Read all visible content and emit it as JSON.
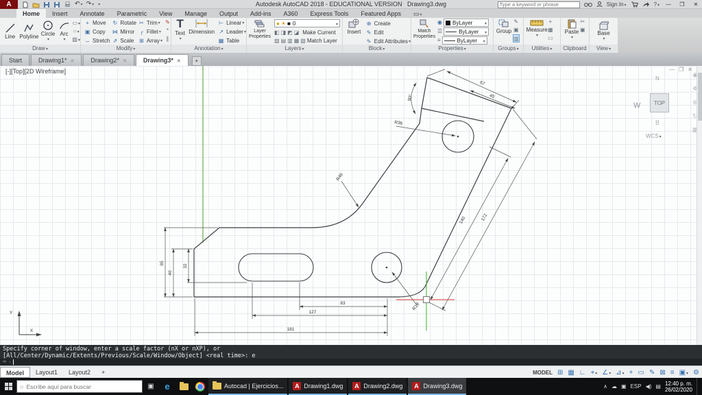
{
  "app": {
    "title": "Autodesk AutoCAD 2018 - EDUCATIONAL VERSION",
    "doc": "Drawing3.dwg",
    "search_placeholder": "Type a keyword or phrase",
    "sign_in": "Sign In"
  },
  "ribbon": {
    "tabs": [
      {
        "label": "Home"
      },
      {
        "label": "Insert"
      },
      {
        "label": "Annotate"
      },
      {
        "label": "Parametric"
      },
      {
        "label": "View"
      },
      {
        "label": "Manage"
      },
      {
        "label": "Output"
      },
      {
        "label": "Add-ins"
      },
      {
        "label": "A360"
      },
      {
        "label": "Express Tools"
      },
      {
        "label": "Featured Apps"
      }
    ],
    "active_tab": "Home",
    "draw": {
      "label": "Draw",
      "big": [
        {
          "label": "Line"
        },
        {
          "label": "Polyline"
        },
        {
          "label": "Circle"
        },
        {
          "label": "Arc"
        }
      ],
      "extra": [
        {
          "name": "rectangle",
          "glyph": "▭"
        },
        {
          "name": "ellipse",
          "glyph": "○"
        },
        {
          "name": "hatch",
          "glyph": "▨"
        }
      ]
    },
    "modify": {
      "label": "Modify",
      "small": [
        {
          "label": "Move",
          "glyph": "+"
        },
        {
          "label": "Copy",
          "glyph": "▣"
        },
        {
          "label": "Stretch",
          "glyph": "↔"
        },
        {
          "label": "Rotate",
          "glyph": "↻"
        },
        {
          "label": "Mirror",
          "glyph": "⋈"
        },
        {
          "label": "Scale",
          "glyph": "⇗"
        },
        {
          "label": "Trim",
          "glyph": "✂"
        },
        {
          "label": "Fillet",
          "glyph": "╭"
        },
        {
          "label": "Array",
          "glyph": "⊞"
        }
      ],
      "extra": [
        {
          "name": "erase",
          "glyph": "✎"
        },
        {
          "name": "explode",
          "glyph": "*"
        },
        {
          "name": "offset",
          "glyph": "∥"
        }
      ]
    },
    "annotation": {
      "label": "Annotation",
      "big": [
        {
          "label": "Text"
        },
        {
          "label": "Dimension"
        }
      ],
      "small": [
        {
          "label": "Linear",
          "glyph": "⊢"
        },
        {
          "label": "Leader",
          "glyph": "↗"
        },
        {
          "label": "Table",
          "glyph": "▦"
        }
      ]
    },
    "layers": {
      "label": "Layers",
      "big_label": "Layer Properties",
      "current_layer": "0",
      "state_glyphs": [
        "●",
        "☀",
        "■"
      ],
      "row2": [
        "◧",
        "◨",
        "◩",
        "◪"
      ],
      "row3": [
        "▨",
        "▤",
        "▥",
        "▦",
        "▧"
      ],
      "small": [
        {
          "label": "Make Current"
        },
        {
          "label": "Match Layer"
        }
      ]
    },
    "block": {
      "label": "Block",
      "big_label": "Insert",
      "small": [
        {
          "label": "Create",
          "glyph": "⊕"
        },
        {
          "label": "Edit",
          "glyph": "✎"
        },
        {
          "label": "Edit Attributes",
          "glyph": "✎"
        }
      ]
    },
    "properties": {
      "label": "Properties",
      "big_label": "Match Properties",
      "row_glyphs": [
        "◉",
        "☰",
        "≡"
      ],
      "rows": [
        {
          "value": "ByLayer"
        },
        {
          "value": "ByLayer"
        },
        {
          "value": "ByLayer"
        }
      ]
    },
    "groups": {
      "label": "Groups",
      "big_label": "Group",
      "extra": [
        {
          "name": "group-edit",
          "glyph": "✎"
        },
        {
          "name": "ungroup",
          "glyph": "▣"
        },
        {
          "name": "group-selection-on",
          "glyph": "▥"
        }
      ]
    },
    "utilities": {
      "label": "Utilities",
      "big_label": "Measure",
      "extra": [
        {
          "name": "id-point",
          "glyph": "+"
        },
        {
          "name": "quick-calculator",
          "glyph": "▦"
        },
        {
          "name": "list",
          "glyph": "▭"
        }
      ]
    },
    "clipboard": {
      "label": "Clipboard",
      "big_label": "Paste",
      "extra": [
        {
          "name": "cut",
          "glyph": "✂"
        },
        {
          "name": "copy-clip",
          "glyph": "▣"
        }
      ]
    },
    "view": {
      "label": "View",
      "big_label": "Base"
    }
  },
  "file_tabs": [
    {
      "label": "Start"
    },
    {
      "label": "Drawing1*"
    },
    {
      "label": "Drawing2*"
    },
    {
      "label": "Drawing3*"
    }
  ],
  "viewport": {
    "controls_label": "[-][Top][2D Wireframe]",
    "viewcube": {
      "north": "N",
      "west": "W",
      "top": "TOP",
      "bottom": "B",
      "wcs": "WCS"
    },
    "ucs": {
      "x": "X",
      "y": "Y"
    }
  },
  "drawing": {
    "dims": {
      "end_face": "67",
      "notch_face": "45",
      "notch_angle": "90°",
      "hole_leader": "R36",
      "arm_inner": "140",
      "arm_outer": "172",
      "left_total": "65",
      "left_outer": "40",
      "left_inner": "32",
      "bottom_inner": "83",
      "bottom_middle": "127",
      "bottom_total": "181",
      "fillet_leader": "R46",
      "corner_leader": "R18"
    }
  },
  "command_line": {
    "line1": "Specify corner of window, enter a scale factor (nX or nXP), or",
    "line2": "[All/Center/Dynamic/Extents/Previous/Scale/Window/Object] <real time>: e"
  },
  "status_bar": {
    "tabs": [
      "Model",
      "Layout1",
      "Layout2"
    ],
    "model_label": "MODEL",
    "icons": [
      {
        "name": "grid",
        "glyph": "⊞"
      },
      {
        "name": "snap-mode",
        "glyph": "▦"
      },
      {
        "name": "ortho",
        "glyph": "∟"
      },
      {
        "name": "polar-tracking",
        "glyph": "⌖"
      },
      {
        "name": "isometric-drafting",
        "glyph": "∠"
      },
      {
        "name": "object-snap-tracking",
        "glyph": "⊿"
      },
      {
        "name": "object-snap",
        "glyph": "+"
      },
      {
        "name": "lineweight",
        "glyph": "▭"
      },
      {
        "name": "dynamic-input",
        "glyph": "✎"
      },
      {
        "name": "selection-cycling",
        "glyph": "⊠"
      },
      {
        "name": "workspace",
        "glyph": "≡"
      },
      {
        "name": "annotation-scale",
        "glyph": "▣"
      },
      {
        "name": "customization",
        "glyph": "⚙"
      }
    ]
  },
  "taskbar": {
    "search_placeholder": "Escribe aquí para buscar",
    "windows": [
      "Autocad | Ejercicios...",
      "Drawing1.dwg",
      "Drawing2.dwg",
      "Drawing3.dwg"
    ],
    "tray_icons": [
      {
        "name": "hidden-icons-chevron",
        "glyph": "∧"
      },
      {
        "name": "onedrive",
        "glyph": "☁"
      },
      {
        "name": "security",
        "glyph": "▣"
      },
      {
        "name": "speaker",
        "glyph": "◀)"
      },
      {
        "name": "network",
        "glyph": "▤"
      }
    ],
    "tray": {
      "language": "ESP",
      "time": "12:40 p. m.",
      "date": "26/02/2020"
    }
  }
}
